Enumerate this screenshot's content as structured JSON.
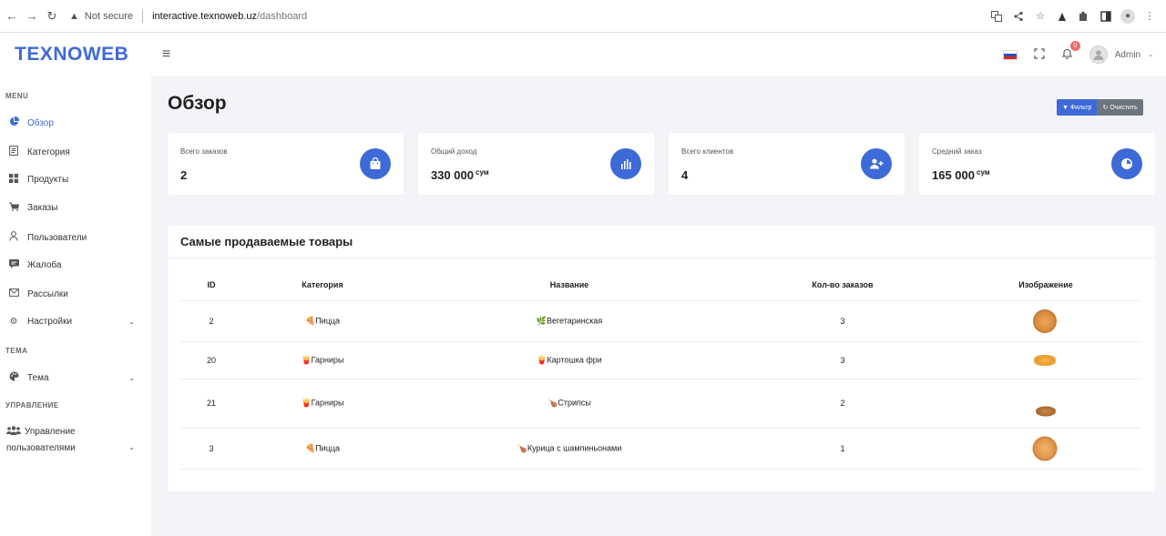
{
  "browser": {
    "back": "←",
    "forward": "→",
    "reload": "↻",
    "security_label": "Not secure",
    "url_host": "interactive.texnoweb.uz",
    "url_path": "/dashboard"
  },
  "header": {
    "logo": "TEXNOWEB",
    "notifications_count": "0",
    "user_name": "Admin"
  },
  "sidebar": {
    "section_menu": "MENU",
    "section_theme": "ТЕМА",
    "section_manage": "УПРАВЛЕНИЕ",
    "items": [
      {
        "label": "Обзор",
        "icon": "pie-chart-icon",
        "active": true
      },
      {
        "label": "Категория",
        "icon": "document-icon"
      },
      {
        "label": "Продукты",
        "icon": "grid-icon"
      },
      {
        "label": "Заказы",
        "icon": "cart-icon"
      },
      {
        "label": "Пользователи",
        "icon": "user-icon"
      },
      {
        "label": "Жалоба",
        "icon": "comment-icon"
      },
      {
        "label": "Рассылки",
        "icon": "mail-icon"
      },
      {
        "label": "Настройки",
        "icon": "gear-icon"
      }
    ],
    "theme_item": "Тема",
    "manage_item_line1": "Управление",
    "manage_item_line2": "пользователями"
  },
  "main": {
    "title": "Обзор",
    "filter_label": "Фильтр",
    "clear_label": "Очистить",
    "stats": [
      {
        "label": "Всего заказов",
        "value": "2",
        "unit": "",
        "icon": "shopping-bag-icon"
      },
      {
        "label": "Общий доход",
        "value": "330 000",
        "unit": "сум",
        "icon": "bar-chart-icon"
      },
      {
        "label": "Всего клиентов",
        "value": "4",
        "unit": "",
        "icon": "user-plus-icon"
      },
      {
        "label": "Средний заказ",
        "value": "165 000",
        "unit": "сум",
        "icon": "clock-pie-icon"
      }
    ],
    "table": {
      "title": "Самые продаваемые товары",
      "headers": [
        "ID",
        "Категория",
        "Название",
        "Кол-во заказов",
        "Изображение"
      ],
      "rows": [
        {
          "id": "2",
          "category_icon": "🍕",
          "category": "Пицца",
          "name_icon": "🌿",
          "name": "Вегетаринская",
          "orders": "3",
          "image": "pizza-image"
        },
        {
          "id": "20",
          "category_icon": "🍟",
          "category": "Гарниры",
          "name_icon": "🍟",
          "name": "Картошка фри",
          "orders": "3",
          "image": "fries-image"
        },
        {
          "id": "21",
          "category_icon": "🍟",
          "category": "Гарниры",
          "name_icon": "🍗",
          "name": "Стрипсы",
          "orders": "2",
          "image": "strips-image"
        },
        {
          "id": "3",
          "category_icon": "🍕",
          "category": "Пицца",
          "name_icon": "🍗",
          "name": "Курица с шампиньонами",
          "orders": "1",
          "image": "pizza-image"
        }
      ]
    }
  },
  "colors": {
    "accent": "#3d6ad6",
    "badge": "#f06b6b",
    "clear_button": "#6c757d"
  }
}
